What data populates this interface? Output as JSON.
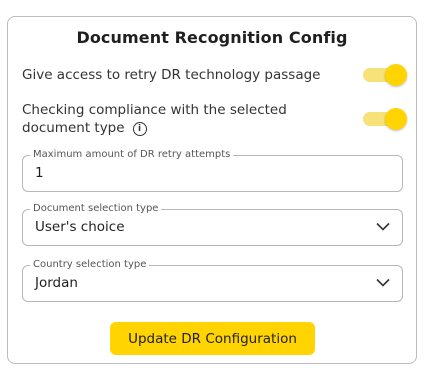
{
  "config": {
    "title": "Document Recognition Config",
    "toggles": [
      {
        "label": "Give access to retry DR technology passage",
        "on": true
      },
      {
        "label_line1": "Checking compliance with the selected",
        "label_line2": "document type",
        "on": true,
        "info_icon": "info-icon"
      }
    ],
    "fields": {
      "retry_attempts": {
        "label": "Maximum amount of DR retry attempts",
        "value": "1"
      },
      "document_selection": {
        "label": "Document selection type",
        "value": "User's choice",
        "icon": "chevron-down-icon"
      },
      "country_selection": {
        "label": "Country selection type",
        "value": "Jordan",
        "icon": "chevron-down-icon"
      }
    },
    "update_button": "Update DR Configuration"
  },
  "colors": {
    "accent": "#ffd400",
    "track": "#f7e27a",
    "border": "#bdbdbd"
  }
}
